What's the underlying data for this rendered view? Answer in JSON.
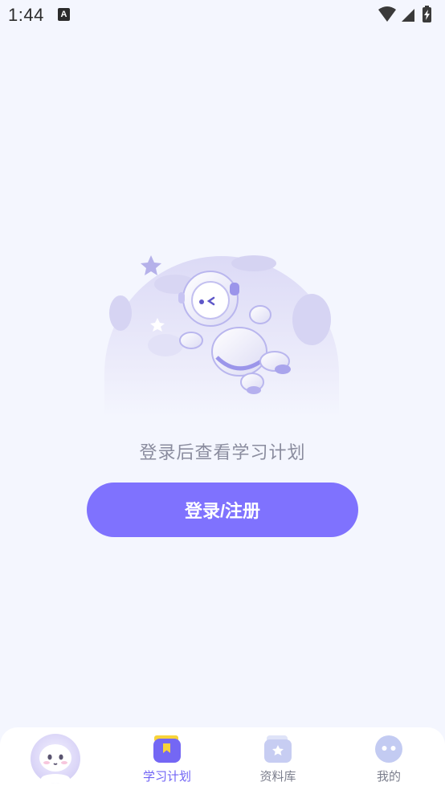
{
  "status_bar": {
    "time": "1:44",
    "app_icon_letter": "A",
    "icons": [
      "wifi-icon",
      "cellular-signal-icon",
      "battery-charging-icon"
    ]
  },
  "main": {
    "empty_message": "登录后查看学习计划",
    "login_button_label": "登录/注册"
  },
  "tab_bar": {
    "tabs": [
      {
        "label": "",
        "icon": "assistant-avatar-icon",
        "active": false
      },
      {
        "label": "学习计划",
        "icon": "study-plan-icon",
        "active": true
      },
      {
        "label": "资料库",
        "icon": "library-icon",
        "active": false
      },
      {
        "label": "我的",
        "icon": "profile-icon",
        "active": false
      }
    ]
  },
  "colors": {
    "background": "#f4f6fe",
    "accent": "#7f72fe",
    "active_tab": "#7063f5",
    "muted_text": "#8a8c9e"
  }
}
